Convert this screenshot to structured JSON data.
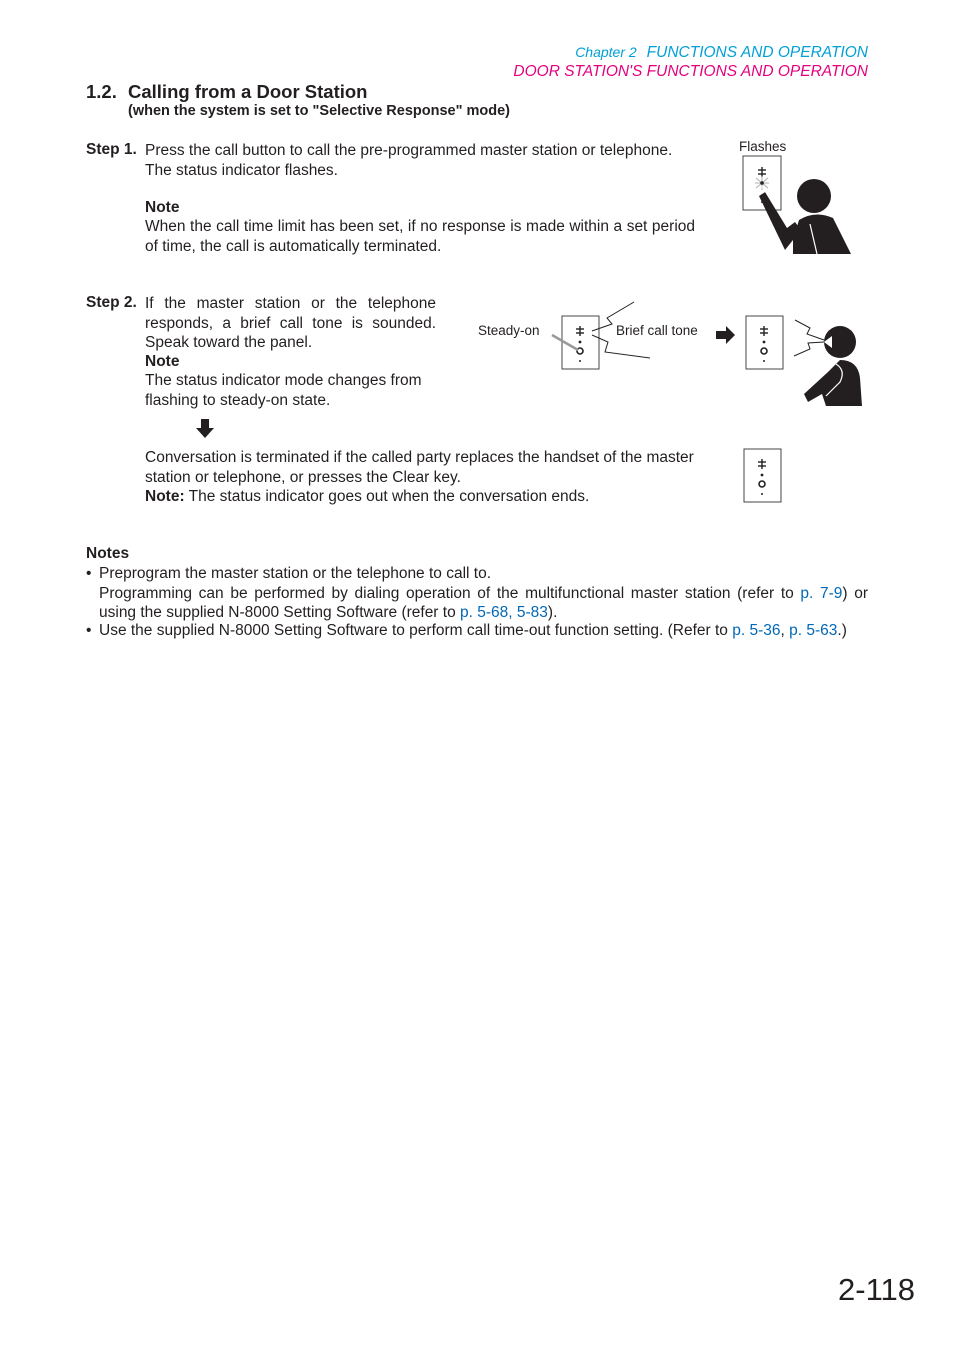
{
  "header": {
    "chapter": "Chapter 2",
    "chapter_title": "FUNCTIONS AND OPERATION",
    "section_title": "DOOR STATION'S FUNCTIONS AND OPERATION"
  },
  "heading": {
    "number": "1.2.",
    "title": "Calling from a Door Station",
    "subtitle": "(when the system is set to \"Selective Response\" mode)"
  },
  "step1": {
    "label": "Step 1.",
    "text_line1": "Press the call button to call the pre-programmed master station or telephone.",
    "text_line2": "The status indicator flashes.",
    "note_label": "Note",
    "note_text": "When the call time limit has been set, if no response is made within a set period of time, the call is automatically terminated.",
    "figure_label": "Flashes"
  },
  "step2": {
    "label": "Step 2.",
    "text": "If the master station or the telephone responds, a brief call tone is sounded. Speak toward the panel.",
    "note_label": "Note",
    "note_text": "The status indicator mode changes from flashing to steady-on state.",
    "figure_label_steady": "Steady-on",
    "figure_label_tone": "Brief call tone"
  },
  "termination": {
    "text": "Conversation is terminated if the called party replaces the handset of the master station or telephone, or presses the Clear key.",
    "note_label": "Note:",
    "note_text": "The status indicator goes out when the conversation ends."
  },
  "notes": {
    "label": "Notes",
    "item1_line1": "Preprogram the master station or the telephone to call to.",
    "item1_text_a": "Programming can be performed by dialing operation of the multifunctional master station (refer to ",
    "item1_link1": "p. 7-9",
    "item1_text_b": ") or using the supplied N-8000 Setting Software (refer to ",
    "item1_link2": "p. 5-68, 5-83",
    "item1_text_c": ").",
    "item2_text_a": "Use the supplied N-8000 Setting Software to perform call time-out function setting. (Refer to ",
    "item2_link1": "p. 5-36",
    "item2_sep": ", ",
    "item2_link2": "p. 5-63",
    "item2_text_b": ".)"
  },
  "page_number": "2-118",
  "colors": {
    "chapter_header": "#00a0d6",
    "section_header": "#e4007f",
    "link": "#0068b7",
    "text": "#231f20"
  }
}
